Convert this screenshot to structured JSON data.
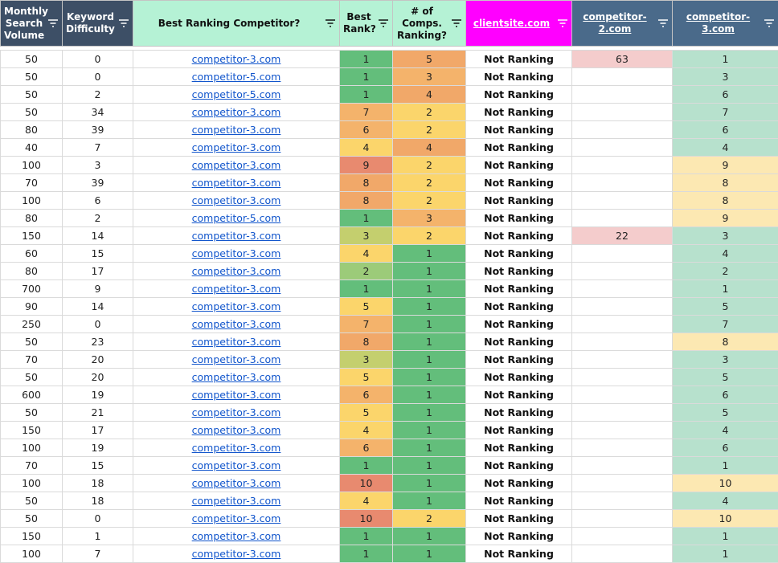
{
  "headers": [
    "Monthly Search Volume",
    "Keyword Difficulty",
    "Best Ranking Competitor?",
    "Best Rank?",
    "# of Comps. Ranking?",
    "clientsite.com",
    "competitor-2.com",
    "competitor-3.com"
  ],
  "colors": {
    "green": "#63be7b",
    "yellow": "#fbd56b",
    "orange": "#f4b36b",
    "orange_dark": "#f1a869",
    "red": "#e88a6f",
    "olive": "#c4cf6e",
    "lightgreen": "#9ccb79",
    "comp_pink": "#f4cccc",
    "comp_mint": "#b7e1cd",
    "comp_yellow": "#fce8b2"
  },
  "rows": [
    {
      "vol": "50",
      "kd": "0",
      "comp": "competitor-3.com",
      "best": "1",
      "count": "5",
      "client": "Not Ranking",
      "c2": "63",
      "c3": "1",
      "bc": "green",
      "cc": "orange_dark",
      "c2c": "comp_pink",
      "c3c": "comp_mint"
    },
    {
      "vol": "50",
      "kd": "0",
      "comp": "competitor-5.com",
      "best": "1",
      "count": "3",
      "client": "Not Ranking",
      "c2": "",
      "c3": "3",
      "bc": "green",
      "cc": "orange",
      "c2c": "",
      "c3c": "comp_mint"
    },
    {
      "vol": "50",
      "kd": "2",
      "comp": "competitor-5.com",
      "best": "1",
      "count": "4",
      "client": "Not Ranking",
      "c2": "",
      "c3": "6",
      "bc": "green",
      "cc": "orange_dark",
      "c2c": "",
      "c3c": "comp_mint"
    },
    {
      "vol": "50",
      "kd": "34",
      "comp": "competitor-3.com",
      "best": "7",
      "count": "2",
      "client": "Not Ranking",
      "c2": "",
      "c3": "7",
      "bc": "orange",
      "cc": "yellow",
      "c2c": "",
      "c3c": "comp_mint"
    },
    {
      "vol": "80",
      "kd": "39",
      "comp": "competitor-3.com",
      "best": "6",
      "count": "2",
      "client": "Not Ranking",
      "c2": "",
      "c3": "6",
      "bc": "orange",
      "cc": "yellow",
      "c2c": "",
      "c3c": "comp_mint"
    },
    {
      "vol": "40",
      "kd": "7",
      "comp": "competitor-3.com",
      "best": "4",
      "count": "4",
      "client": "Not Ranking",
      "c2": "",
      "c3": "4",
      "bc": "yellow",
      "cc": "orange_dark",
      "c2c": "",
      "c3c": "comp_mint"
    },
    {
      "vol": "100",
      "kd": "3",
      "comp": "competitor-3.com",
      "best": "9",
      "count": "2",
      "client": "Not Ranking",
      "c2": "",
      "c3": "9",
      "bc": "red",
      "cc": "yellow",
      "c2c": "",
      "c3c": "comp_yellow"
    },
    {
      "vol": "70",
      "kd": "39",
      "comp": "competitor-3.com",
      "best": "8",
      "count": "2",
      "client": "Not Ranking",
      "c2": "",
      "c3": "8",
      "bc": "orange_dark",
      "cc": "yellow",
      "c2c": "",
      "c3c": "comp_yellow"
    },
    {
      "vol": "100",
      "kd": "6",
      "comp": "competitor-3.com",
      "best": "8",
      "count": "2",
      "client": "Not Ranking",
      "c2": "",
      "c3": "8",
      "bc": "orange_dark",
      "cc": "yellow",
      "c2c": "",
      "c3c": "comp_yellow"
    },
    {
      "vol": "80",
      "kd": "2",
      "comp": "competitor-5.com",
      "best": "1",
      "count": "3",
      "client": "Not Ranking",
      "c2": "",
      "c3": "9",
      "bc": "green",
      "cc": "orange",
      "c2c": "",
      "c3c": "comp_yellow"
    },
    {
      "vol": "150",
      "kd": "14",
      "comp": "competitor-3.com",
      "best": "3",
      "count": "2",
      "client": "Not Ranking",
      "c2": "22",
      "c3": "3",
      "bc": "olive",
      "cc": "yellow",
      "c2c": "comp_pink",
      "c3c": "comp_mint"
    },
    {
      "vol": "60",
      "kd": "15",
      "comp": "competitor-3.com",
      "best": "4",
      "count": "1",
      "client": "Not Ranking",
      "c2": "",
      "c3": "4",
      "bc": "yellow",
      "cc": "green",
      "c2c": "",
      "c3c": "comp_mint"
    },
    {
      "vol": "80",
      "kd": "17",
      "comp": "competitor-3.com",
      "best": "2",
      "count": "1",
      "client": "Not Ranking",
      "c2": "",
      "c3": "2",
      "bc": "lightgreen",
      "cc": "green",
      "c2c": "",
      "c3c": "comp_mint"
    },
    {
      "vol": "700",
      "kd": "9",
      "comp": "competitor-3.com",
      "best": "1",
      "count": "1",
      "client": "Not Ranking",
      "c2": "",
      "c3": "1",
      "bc": "green",
      "cc": "green",
      "c2c": "",
      "c3c": "comp_mint"
    },
    {
      "vol": "90",
      "kd": "14",
      "comp": "competitor-3.com",
      "best": "5",
      "count": "1",
      "client": "Not Ranking",
      "c2": "",
      "c3": "5",
      "bc": "yellow",
      "cc": "green",
      "c2c": "",
      "c3c": "comp_mint"
    },
    {
      "vol": "250",
      "kd": "0",
      "comp": "competitor-3.com",
      "best": "7",
      "count": "1",
      "client": "Not Ranking",
      "c2": "",
      "c3": "7",
      "bc": "orange",
      "cc": "green",
      "c2c": "",
      "c3c": "comp_mint"
    },
    {
      "vol": "50",
      "kd": "23",
      "comp": "competitor-3.com",
      "best": "8",
      "count": "1",
      "client": "Not Ranking",
      "c2": "",
      "c3": "8",
      "bc": "orange_dark",
      "cc": "green",
      "c2c": "",
      "c3c": "comp_yellow"
    },
    {
      "vol": "70",
      "kd": "20",
      "comp": "competitor-3.com",
      "best": "3",
      "count": "1",
      "client": "Not Ranking",
      "c2": "",
      "c3": "3",
      "bc": "olive",
      "cc": "green",
      "c2c": "",
      "c3c": "comp_mint"
    },
    {
      "vol": "50",
      "kd": "20",
      "comp": "competitor-3.com",
      "best": "5",
      "count": "1",
      "client": "Not Ranking",
      "c2": "",
      "c3": "5",
      "bc": "yellow",
      "cc": "green",
      "c2c": "",
      "c3c": "comp_mint"
    },
    {
      "vol": "600",
      "kd": "19",
      "comp": "competitor-3.com",
      "best": "6",
      "count": "1",
      "client": "Not Ranking",
      "c2": "",
      "c3": "6",
      "bc": "orange",
      "cc": "green",
      "c2c": "",
      "c3c": "comp_mint"
    },
    {
      "vol": "50",
      "kd": "21",
      "comp": "competitor-3.com",
      "best": "5",
      "count": "1",
      "client": "Not Ranking",
      "c2": "",
      "c3": "5",
      "bc": "yellow",
      "cc": "green",
      "c2c": "",
      "c3c": "comp_mint"
    },
    {
      "vol": "150",
      "kd": "17",
      "comp": "competitor-3.com",
      "best": "4",
      "count": "1",
      "client": "Not Ranking",
      "c2": "",
      "c3": "4",
      "bc": "yellow",
      "cc": "green",
      "c2c": "",
      "c3c": "comp_mint"
    },
    {
      "vol": "100",
      "kd": "19",
      "comp": "competitor-3.com",
      "best": "6",
      "count": "1",
      "client": "Not Ranking",
      "c2": "",
      "c3": "6",
      "bc": "orange",
      "cc": "green",
      "c2c": "",
      "c3c": "comp_mint"
    },
    {
      "vol": "70",
      "kd": "15",
      "comp": "competitor-3.com",
      "best": "1",
      "count": "1",
      "client": "Not Ranking",
      "c2": "",
      "c3": "1",
      "bc": "green",
      "cc": "green",
      "c2c": "",
      "c3c": "comp_mint"
    },
    {
      "vol": "100",
      "kd": "18",
      "comp": "competitor-3.com",
      "best": "10",
      "count": "1",
      "client": "Not Ranking",
      "c2": "",
      "c3": "10",
      "bc": "red",
      "cc": "green",
      "c2c": "",
      "c3c": "comp_yellow"
    },
    {
      "vol": "50",
      "kd": "18",
      "comp": "competitor-3.com",
      "best": "4",
      "count": "1",
      "client": "Not Ranking",
      "c2": "",
      "c3": "4",
      "bc": "yellow",
      "cc": "green",
      "c2c": "",
      "c3c": "comp_mint"
    },
    {
      "vol": "50",
      "kd": "0",
      "comp": "competitor-3.com",
      "best": "10",
      "count": "2",
      "client": "Not Ranking",
      "c2": "",
      "c3": "10",
      "bc": "red",
      "cc": "yellow",
      "c2c": "",
      "c3c": "comp_yellow"
    },
    {
      "vol": "150",
      "kd": "1",
      "comp": "competitor-3.com",
      "best": "1",
      "count": "1",
      "client": "Not Ranking",
      "c2": "",
      "c3": "1",
      "bc": "green",
      "cc": "green",
      "c2c": "",
      "c3c": "comp_mint"
    },
    {
      "vol": "100",
      "kd": "7",
      "comp": "competitor-3.com",
      "best": "1",
      "count": "1",
      "client": "Not Ranking",
      "c2": "",
      "c3": "1",
      "bc": "green",
      "cc": "green",
      "c2c": "",
      "c3c": "comp_mint"
    }
  ]
}
